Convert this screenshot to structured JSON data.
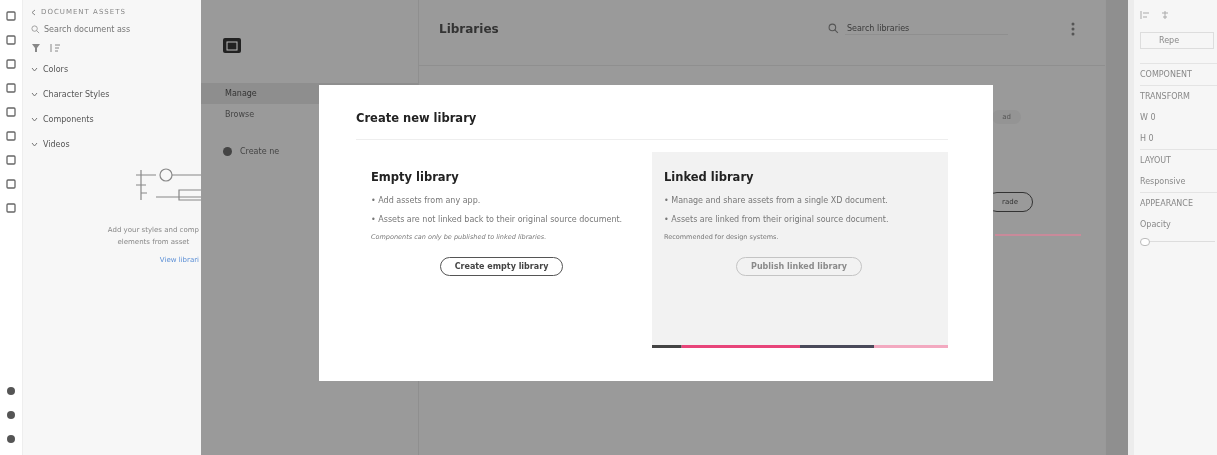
{
  "assets_panel": {
    "back_label": "DOCUMENT ASSETS",
    "search": {
      "placeholder": "Search document ass"
    },
    "sections": [
      "Colors",
      "Character Styles",
      "Components",
      "Videos"
    ],
    "empty_state": {
      "lines": [
        "Add your styles and comp",
        "elements from asset"
      ],
      "link": "View librari"
    }
  },
  "libraries": {
    "title": "Libraries",
    "search": {
      "placeholder": "Search libraries"
    },
    "nav": [
      {
        "label": "Manage",
        "selected": true
      },
      {
        "label": "Browse",
        "selected": false
      }
    ],
    "create_label": "Create ne",
    "pill": "ad",
    "button": "rade"
  },
  "dialog": {
    "title": "Create new library",
    "options": [
      {
        "heading": "Empty library",
        "bullets": [
          "• Add assets from any app.",
          "• Assets are not linked back to their original source document."
        ],
        "note": "Components can only be published to linked libraries.",
        "button": "Create empty library",
        "highlighted": false,
        "disabled": false
      },
      {
        "heading": "Linked library",
        "bullets": [
          "• Manage and share assets from a single XD document.",
          "• Assets are linked from their original source document."
        ],
        "note": "Recommended for design systems.",
        "button": "Publish linked library",
        "highlighted": true,
        "disabled": true
      }
    ]
  },
  "properties": [
    {
      "kind": "field",
      "text": "Repe"
    },
    {
      "kind": "section",
      "text": "COMPONENT"
    },
    {
      "kind": "section",
      "text": "TRANSFORM"
    },
    {
      "kind": "prop",
      "text": "W 0"
    },
    {
      "kind": "prop",
      "text": "H 0"
    },
    {
      "kind": "section",
      "text": "LAYOUT"
    },
    {
      "kind": "prop",
      "text": "Responsive"
    },
    {
      "kind": "section",
      "text": "APPEARANCE"
    },
    {
      "kind": "prop",
      "text": "Opacity"
    },
    {
      "kind": "slider",
      "level": 0
    }
  ]
}
